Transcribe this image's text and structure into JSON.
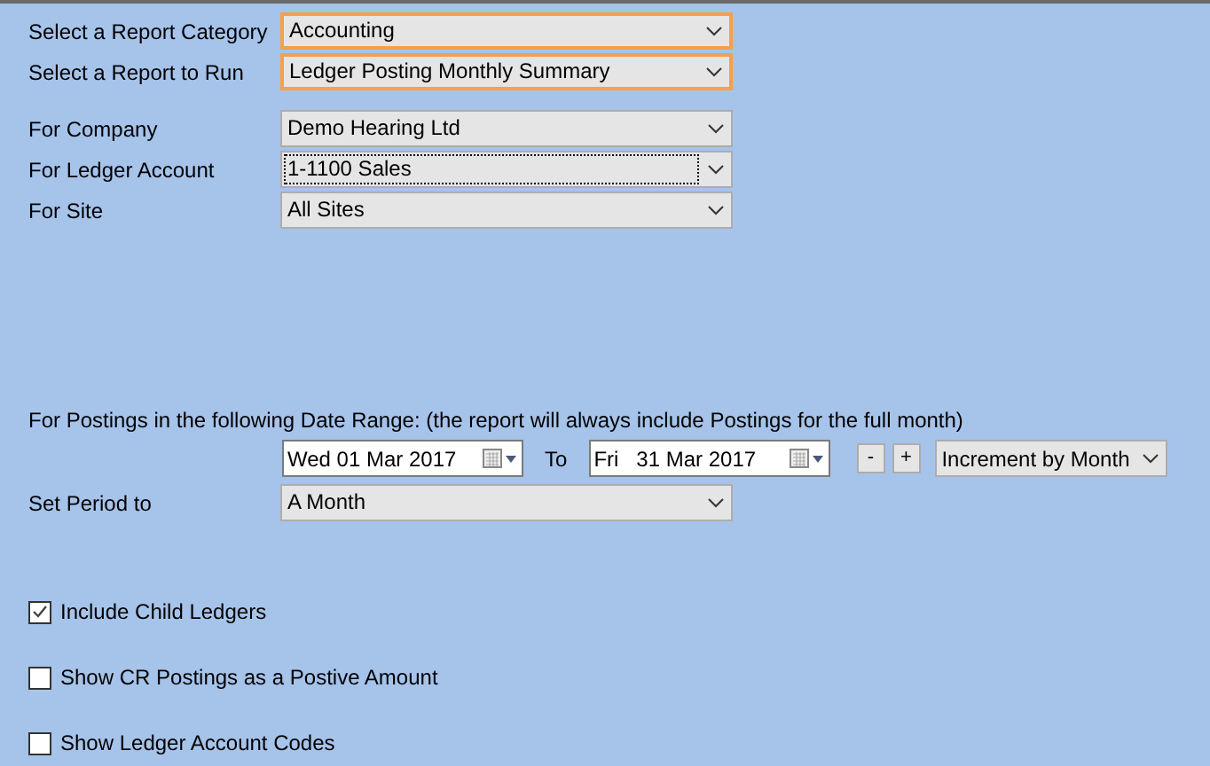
{
  "report_selectors": [
    {
      "label": "Select a Report Category",
      "value": "Accounting",
      "highlighted": true,
      "focused": false
    },
    {
      "label": "Select a Report to Run",
      "value": "Ledger Posting Monthly Summary",
      "highlighted": true,
      "focused": false
    }
  ],
  "filters": [
    {
      "label": "For Company",
      "value": "Demo Hearing Ltd",
      "highlighted": false,
      "focused": false
    },
    {
      "label": "For Ledger Account",
      "value": "1-1100 Sales",
      "highlighted": false,
      "focused": true
    },
    {
      "label": "For Site",
      "value": "All Sites",
      "highlighted": false,
      "focused": false
    }
  ],
  "date_range": {
    "label": "For Postings in the following Date Range: (the report will always include Postings for the full month)",
    "from": "Wed 01 Mar 2017",
    "to_label": "To",
    "to": "Fri   31 Mar 2017",
    "minus": "-",
    "plus": "+",
    "increment": "Increment by Month"
  },
  "period": {
    "label": "Set Period to",
    "value": "A Month",
    "highlighted": false,
    "focused": false
  },
  "options": [
    {
      "label": "Include Child Ledgers",
      "checked": true
    },
    {
      "label": "Show CR Postings as a Postive Amount",
      "checked": false
    },
    {
      "label": "Show Ledger Account Codes",
      "checked": false
    }
  ]
}
